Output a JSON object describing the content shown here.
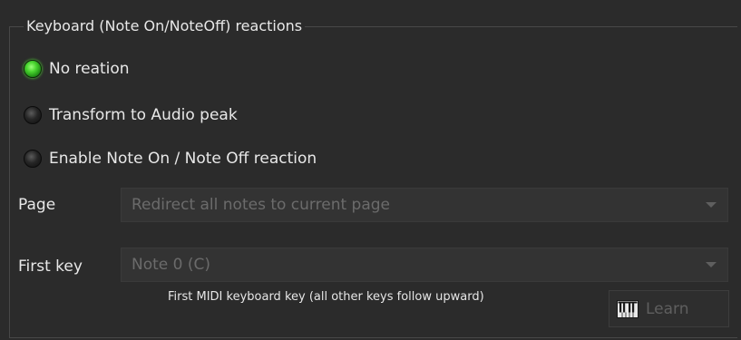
{
  "group": {
    "title": "Keyboard (Note On/NoteOff) reactions"
  },
  "reactions": {
    "options": [
      {
        "label": "No reation",
        "selected": true
      },
      {
        "label": "Transform to Audio peak",
        "selected": false
      },
      {
        "label": "Enable Note On / Note Off reaction",
        "selected": false
      }
    ]
  },
  "page_field": {
    "label": "Page",
    "value": "Redirect all notes to current page"
  },
  "first_key_field": {
    "label": "First key",
    "value": "Note 0 (C)",
    "hint": "First MIDI keyboard key (all other keys follow upward)"
  },
  "learn_button": {
    "label": "Learn",
    "icon": "keyboard-icon"
  },
  "colors": {
    "background": "#2b2b2b",
    "radio_on": "#49d52f",
    "text": "#e8e8e8",
    "disabled_text": "#6b6b6b"
  }
}
